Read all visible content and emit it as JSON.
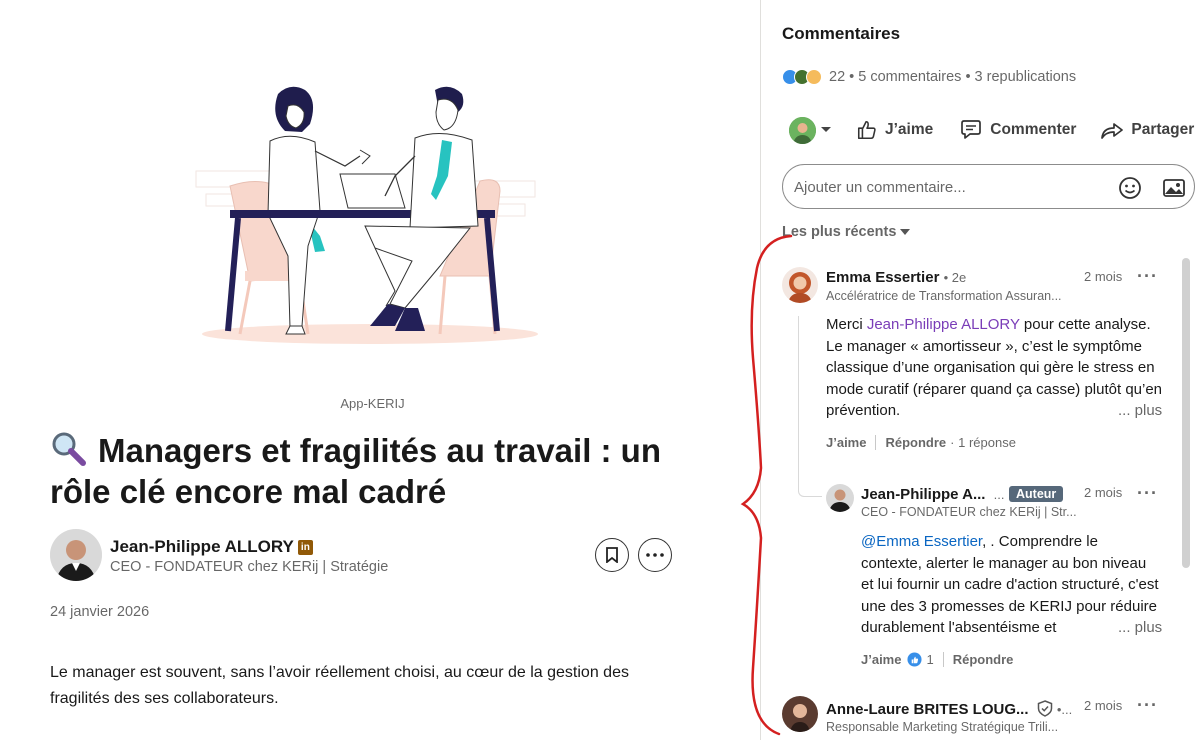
{
  "article": {
    "image_caption": "App-KERIJ",
    "title": "Managers et fragilités au travail : un rôle clé encore mal cadré",
    "author": {
      "name": "Jean-Philippe ALLORY",
      "badge": "in",
      "headline": "CEO - FONDATEUR chez KERij | Stratégie"
    },
    "date": "24 janvier 2026",
    "body": "Le manager est souvent, sans l’avoir réellement choisi, au cœur de la gestion des fragilités des ses collaborateurs."
  },
  "comments_panel": {
    "title": "Commentaires",
    "social_counts": "22 • 5 commentaires • 3 republications",
    "actions": {
      "like": "J’aime",
      "comment": "Commenter",
      "share": "Partager"
    },
    "comment_input": {
      "placeholder": "Ajouter un commentaire..."
    },
    "sort_label": "Les plus récents",
    "comments": [
      {
        "name": "Emma Essertier",
        "degree": "• 2e",
        "headline": "Accélératrice de Transformation Assuran...",
        "time": "2 mois",
        "text_prefix": "Merci ",
        "mention": "Jean-Philippe ALLORY",
        "text_suffix": " pour cette analyse. Le manager « amortisseur », c’est le symptôme classique d’une organisation qui gère le stress en mode curatif (réparer quand ça casse) plutôt qu’en prévention.",
        "see_more": "... plus",
        "like": "J’aime",
        "reply": "Répondre",
        "reply_count": "· 1 réponse"
      },
      {
        "name": "Jean-Philippe A...",
        "degree": "...",
        "badge": "Auteur",
        "headline": "CEO - FONDATEUR chez KERij | Str...",
        "time": "2 mois",
        "mention": "@Emma Essertier",
        "text_suffix": ", . Comprendre le contexte, alerter le manager au bon niveau et lui fournir un cadre d'action structuré, c'est une des 3 promesses de KERIJ pour réduire durablement l'absentéisme et",
        "see_more": "... plus",
        "like": "J’aime",
        "reaction_count": "1",
        "reply": "Répondre"
      },
      {
        "name": "Anne-Laure BRITES LOUG...",
        "degree": "•...",
        "headline": "Responsable Marketing Stratégique Trili...",
        "time": "2 mois"
      }
    ]
  },
  "colors": {
    "mention_purple": "#7a3db8",
    "link_blue": "#0a66c2",
    "author_badge": "#56687a",
    "annotation_red": "#d42020",
    "premium_gold": "#915907"
  }
}
